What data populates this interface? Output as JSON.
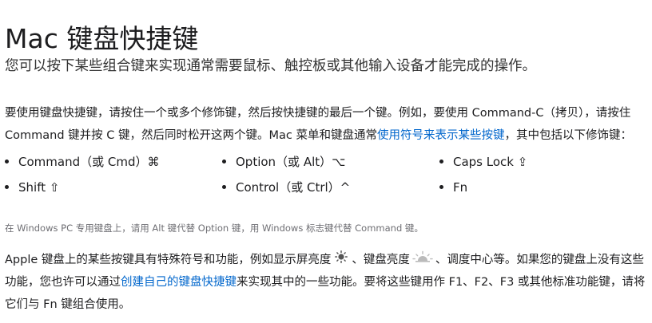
{
  "page": {
    "title": "Mac 键盘快捷键",
    "intro": "您可以按下某些组合键来实现通常需要鼠标、触控板或其他输入设备才能完成的操作。"
  },
  "para1": {
    "line1": "要使用键盘快捷键，请按住一个或多个修饰键，然后按快捷键的最后一个键。例如，要使用 Command-C（拷贝），请按住",
    "line2_before": "Command 键并按 C 键，然后同时松开这两个键。Mac 菜单和键盘通常",
    "link": "使用符号来表示某些按键",
    "line2_after": "，其中包括以下修饰键："
  },
  "modifier_keys": [
    {
      "label": "Command（或 Cmd）⌘"
    },
    {
      "label": "Option（或 Alt）⌥"
    },
    {
      "label": "Caps Lock ⇪"
    },
    {
      "label": "Shift ⇧"
    },
    {
      "label": "Control（或 Ctrl）^"
    },
    {
      "label": "Fn"
    }
  ],
  "note": "在 Windows PC 专用键盘上，请用 Alt 键代替 Option 键，用 Windows 标志键代替 Command 键。",
  "para2": {
    "line1_a": "Apple 键盘上的某些按键具有特殊符号和功能，例如显示屏亮度",
    "line1_b": "、键盘亮度",
    "line1_c": "、调度中心等。如果您的键盘上没有这些",
    "line2_before": "功能，您也许可以通过",
    "link": "创建自己的键盘快捷键",
    "line2_after": "来实现其中的一些功能。要将这些键用作 F1、F2、F3 或其他标准功能键，请将",
    "line3": "它们与 Fn 键组合使用。"
  },
  "colors": {
    "link": "#0066cc",
    "text": "#1d1d1f",
    "muted": "#6e6e73"
  },
  "icons": [
    "display-brightness-icon",
    "keyboard-brightness-icon"
  ]
}
